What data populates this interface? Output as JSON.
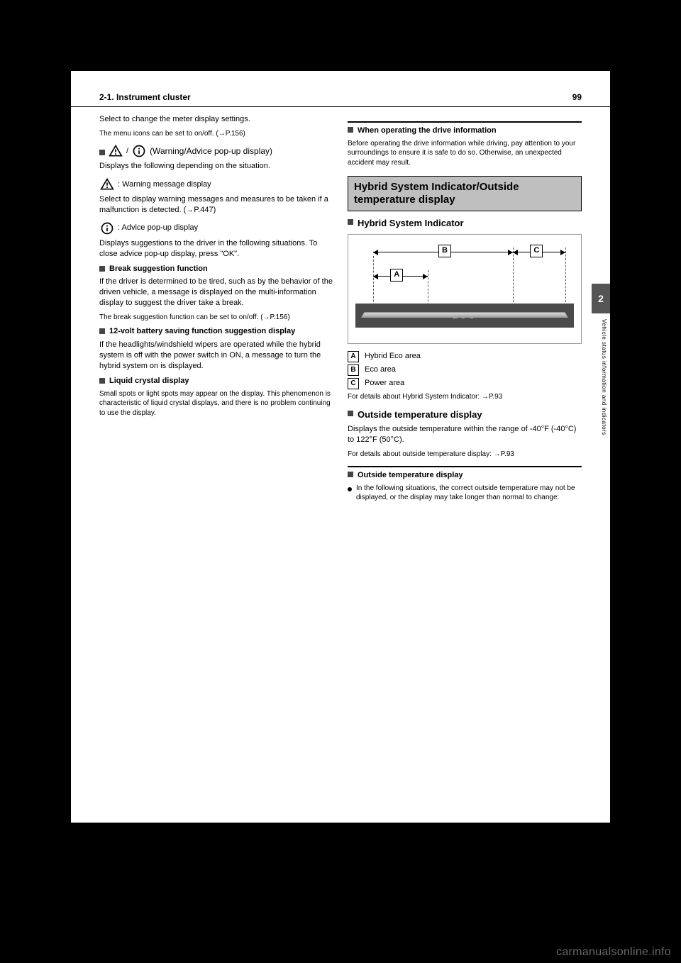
{
  "header": {
    "section": "2-1. Instrument cluster",
    "page_number": "99"
  },
  "side": {
    "chapter_number": "2",
    "chapter_title": "Vehicle status information and indicators"
  },
  "left_col": {
    "settings_intro": "Select to change the meter display settings.",
    "p156_ref": "The menu icons can be set to on/off. (→P.156)",
    "icons_heading_suffix": "(Warning/Advice pop-up display)",
    "icons_text": "Displays the following depending on the situation.",
    "warning_label": ": Warning message display",
    "warning_text": "Select to display warning messages and measures to be taken if a malfunction is detected. (→P.447)",
    "advice_label": ": Advice pop-up display",
    "advice_text": "Displays suggestions to the driver in the following situations. To close advice pop-up display, press  \"OK\".",
    "break_heading": "Break suggestion function",
    "break_text": "If the driver is determined to be tired, such as by the behavior of the driven vehicle, a message is displayed on the multi-information display to suggest the driver take a break.",
    "break_note": "The break suggestion function can be set to on/off. (→P.156)",
    "battery_heading": "12-volt battery saving function suggestion display",
    "battery_text": "If the headlights/windshield wipers are operated while the hybrid system is off with the power switch in ON, a message to turn the hybrid system on is displayed.",
    "liquid_heading": "Liquid crystal display",
    "liquid_text": "Small spots or light spots may appear on the display. This phenomenon is characteristic of liquid crystal displays, and there is no problem continuing to use the display."
  },
  "right_col": {
    "caution_heading": "When operating the drive information",
    "caution_text": "Before operating the drive information while driving, pay attention to your surroundings to ensure it is safe to do so. Otherwise, an unexpected accident may result.",
    "section_title": "Hybrid System Indicator/Outside temperature display",
    "hsi_heading": "Hybrid System Indicator",
    "diagram": {
      "label_a": "A",
      "label_b": "B",
      "label_c": "C",
      "eco_text": "ECO"
    },
    "desc_a": "Hybrid Eco area",
    "desc_b": "Eco area",
    "desc_c": "Power area",
    "desc_note": "For details about Hybrid System Indicator: →P.93",
    "outside_heading": "Outside temperature display",
    "outside_text": "Displays the outside temperature within the range of -40°F (-40°C) to 122°F (50°C).",
    "outside_note": "For details about outside temperature display: →P.93",
    "temp_info_heading": "Outside temperature display",
    "temp_bullet": "In the following situations, the correct outside temperature may not be displayed, or the display may take longer than normal to change:"
  },
  "watermark": "carmanualsonline.info"
}
